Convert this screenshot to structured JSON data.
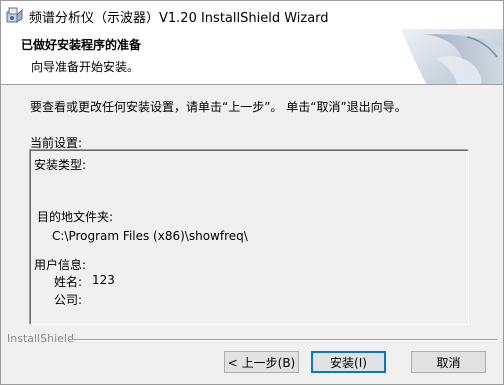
{
  "window": {
    "title": "频谱分析仪（示波器）V1.20 InstallShield Wizard"
  },
  "header": {
    "title": "已做好安装程序的准备",
    "subtitle": "向导准备开始安装。"
  },
  "body": {
    "instruction": "要查看或更改任何安装设置，请单击“上一步”。 单击“取消”退出向导。",
    "settings_label": "当前设置:"
  },
  "settings": {
    "setup_type_label": "安装类型:",
    "destination_label": "目的地文件夹:",
    "destination_path": "C:\\Program Files (x86)\\showfreq\\",
    "user_info_label": "用户信息:",
    "name_label": "姓名:",
    "name_value": "123",
    "company_label": "公司:"
  },
  "footer": {
    "brand": "InstallShield"
  },
  "buttons": {
    "back": "< 上一步(B)",
    "install": "安装(I)",
    "cancel": "取消"
  },
  "colors": {
    "default_button_border": "#0078d7",
    "background": "#f0f0f0"
  },
  "icons": {
    "title_icon": "installer-icon",
    "header_graphic": "folded-page-graphic"
  }
}
